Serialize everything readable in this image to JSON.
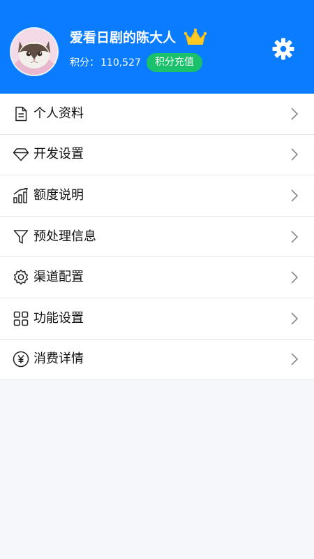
{
  "profile": {
    "username": "爱看日剧的陈大人",
    "points_label": "积分：",
    "points_value": "110,527",
    "recharge_label": "积分充值"
  },
  "menu": {
    "items": [
      {
        "label": "个人资料",
        "icon": "document-icon"
      },
      {
        "label": "开发设置",
        "icon": "diamond-icon"
      },
      {
        "label": "额度说明",
        "icon": "chart-trend-icon"
      },
      {
        "label": "预处理信息",
        "icon": "filter-icon"
      },
      {
        "label": "渠道配置",
        "icon": "gear-outline-icon"
      },
      {
        "label": "功能设置",
        "icon": "grid-icon"
      },
      {
        "label": "消费详情",
        "icon": "yen-circle-icon"
      }
    ]
  },
  "colors": {
    "header_bg": "#0A7CFF",
    "recharge_bg": "#18C16A",
    "crown": "#FFC928",
    "page_bg": "#F5F7FA"
  }
}
